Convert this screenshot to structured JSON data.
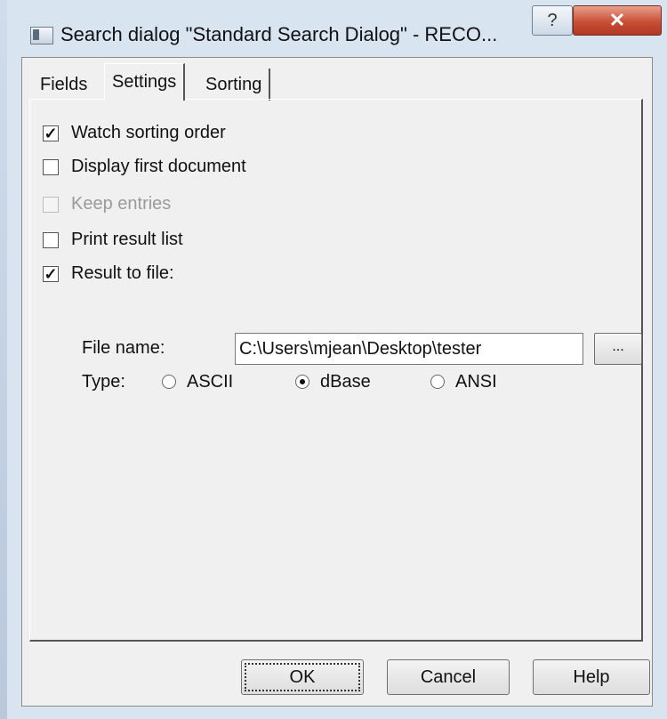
{
  "window": {
    "title": "Search dialog \"Standard Search Dialog\" - RECO...",
    "help_glyph": "?",
    "close_glyph": "✕",
    "accent_close": "#c94f36"
  },
  "tabs": [
    {
      "label": "Fields",
      "active": false
    },
    {
      "label": "Settings",
      "active": true
    },
    {
      "label": "Sorting",
      "active": false
    }
  ],
  "settings": {
    "options": [
      {
        "label": "Watch sorting order",
        "checked": true,
        "enabled": true
      },
      {
        "label": "Display first document",
        "checked": false,
        "enabled": true
      },
      {
        "label": "Keep entries",
        "checked": false,
        "enabled": false
      },
      {
        "label": "Print result list",
        "checked": false,
        "enabled": true
      },
      {
        "label": "Result to file:",
        "checked": true,
        "enabled": true
      }
    ],
    "file_name_label": "File name:",
    "file_name_value": "C:\\Users\\mjean\\Desktop\\tester",
    "browse_label": "...",
    "type_label": "Type:",
    "types": [
      {
        "label": "ASCII",
        "selected": false
      },
      {
        "label": "dBase",
        "selected": true
      },
      {
        "label": "ANSI",
        "selected": false
      }
    ]
  },
  "buttons": {
    "ok": "OK",
    "cancel": "Cancel",
    "help": "Help"
  }
}
